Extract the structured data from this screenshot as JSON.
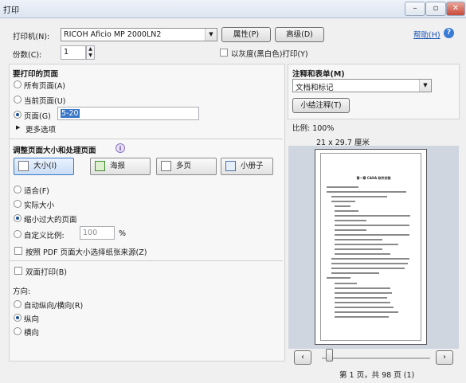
{
  "window": {
    "title": "打印"
  },
  "top": {
    "printer_label": "打印机(N):",
    "printer_value": "RICOH Aficio MP 2000LN2",
    "properties_btn": "属性(P)",
    "advanced_btn": "高级(D)",
    "help_link": "帮助(H)",
    "copies_label": "份数(C):",
    "copies_value": "1",
    "grayscale_label": "以灰度(黑白色)打印(Y)"
  },
  "pages": {
    "heading": "要打印的页面",
    "all": "所有页面(A)",
    "current": "当前页面(U)",
    "pages_label": "页面(G)",
    "pages_value": "5-20",
    "more": "更多选项"
  },
  "sizing": {
    "heading": "调整页面大小和处理页面",
    "modes": [
      "大小(I)",
      "海报",
      "多页",
      "小册子"
    ],
    "fit": "适合(F)",
    "actual": "实际大小",
    "shrink": "缩小过大的页面",
    "custom": "自定义比例:",
    "custom_value": "100",
    "percent": "%",
    "paper_source": "按照 PDF 页面大小选择纸张来源(Z)"
  },
  "duplex": {
    "label": "双面打印(B)",
    "orientation_label": "方向:",
    "auto": "自动纵向/横向(R)",
    "portrait": "纵向",
    "landscape": "横向"
  },
  "comments": {
    "heading": "注释和表单(M)",
    "value": "文档和标记",
    "summarize_btn": "小结注释(T)"
  },
  "preview": {
    "scale": "比例: 100%",
    "paper": "21 x 29.7 厘米",
    "page_status": "第 1 页，共 98 页 (1)",
    "doc_title": "第一章 CAXA 软件安装",
    "zoom": 0.12
  },
  "colors": {
    "accent": "#3a77c6",
    "link": "#1b55b5"
  }
}
